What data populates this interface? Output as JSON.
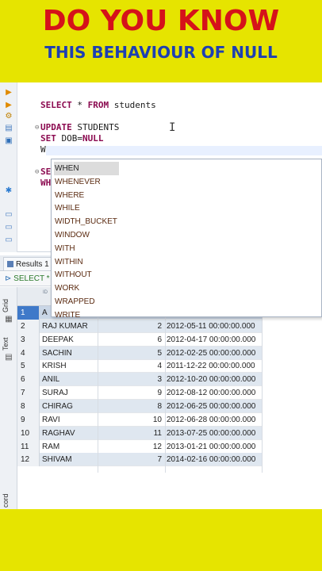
{
  "banner": {
    "line1": "DO YOU KNOW",
    "line2": "THIS BEHAVIOUR OF NULL"
  },
  "colors": {
    "banner_bg": "#e6e400",
    "line1": "#d5121a",
    "line2": "#1d3fb3",
    "keyword": "#8b0a50"
  },
  "editor": {
    "line1": {
      "kw1": "SELECT",
      "rest1": " * ",
      "kw2": "FROM",
      "rest2": " students"
    },
    "line2": {
      "kw1": "UPDATE",
      "rest1": " STUDENTS"
    },
    "line3": {
      "kw1": "SET",
      "rest1": " DOB=",
      "kw2": "NULL"
    },
    "line4": {
      "text": "W"
    },
    "line5": {
      "text": "SE"
    },
    "line6": {
      "text": "WH"
    }
  },
  "autocomplete": {
    "items": [
      "WHEN",
      "WHENEVER",
      "WHERE",
      "WHILE",
      "WIDTH_BUCKET",
      "WINDOW",
      "WITH",
      "WITHIN",
      "WITHOUT",
      "WORK",
      "WRAPPED",
      "WRITE"
    ],
    "selected": "WHEN"
  },
  "results": {
    "tab_label": "Results 1",
    "filter_text": "SELECT *",
    "side_labels": {
      "grid": "Grid",
      "text": "Text",
      "record": "cord"
    },
    "header_labels": {
      "id": "ID",
      "name": ""
    },
    "rows": [
      {
        "n": "1",
        "name": "A",
        "id": "",
        "dob": ""
      },
      {
        "n": "2",
        "name": "RAJ KUMAR",
        "id": "2",
        "dob": "2012-05-11 00:00:00.000"
      },
      {
        "n": "3",
        "name": "DEEPAK",
        "id": "6",
        "dob": "2012-04-17 00:00:00.000"
      },
      {
        "n": "4",
        "name": "SACHIN",
        "id": "5",
        "dob": "2012-02-25 00:00:00.000"
      },
      {
        "n": "5",
        "name": "KRISH",
        "id": "4",
        "dob": "2011-12-22 00:00:00.000"
      },
      {
        "n": "6",
        "name": "ANIL",
        "id": "3",
        "dob": "2012-10-20 00:00:00.000"
      },
      {
        "n": "7",
        "name": "SURAJ",
        "id": "9",
        "dob": "2012-08-12 00:00:00.000"
      },
      {
        "n": "8",
        "name": "CHIRAG",
        "id": "8",
        "dob": "2012-06-25 00:00:00.000"
      },
      {
        "n": "9",
        "name": "RAVI",
        "id": "10",
        "dob": "2012-06-28 00:00:00.000"
      },
      {
        "n": "10",
        "name": "RAGHAV",
        "id": "11",
        "dob": "2013-07-25 00:00:00.000"
      },
      {
        "n": "11",
        "name": "RAM",
        "id": "12",
        "dob": "2013-01-21 00:00:00.000"
      },
      {
        "n": "12",
        "name": "SHIVAM",
        "id": "7",
        "dob": "2014-02-16 00:00:00.000"
      }
    ]
  }
}
